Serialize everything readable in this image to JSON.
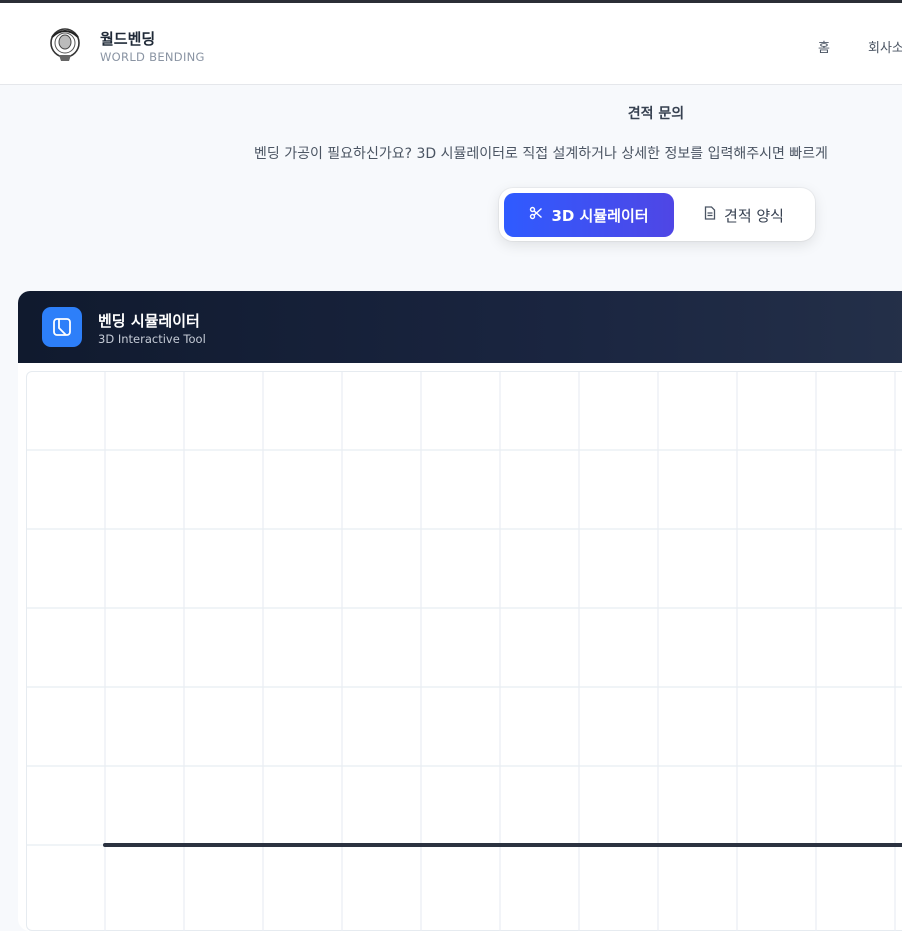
{
  "header": {
    "brand_ko": "월드벤딩",
    "brand_en": "WORLD BENDING",
    "nav": [
      "홈",
      "회사소"
    ]
  },
  "main": {
    "title": "견적 문의",
    "subtitle": "벤딩 가공이 필요하신가요? 3D 시뮬레이터로 직접 설계하거나 상세한 정보를 입력해주시면 빠르게",
    "tabs": [
      {
        "label": "3D 시뮬레이터",
        "icon": "scissors-icon",
        "active": true
      },
      {
        "label": "견적 양식",
        "icon": "document-icon",
        "active": false
      }
    ]
  },
  "simulator": {
    "title": "벤딩 시뮬레이터",
    "subtitle": "3D Interactive Tool",
    "icon": "bend-icon"
  },
  "colors": {
    "accent": "#2f5bff",
    "header_dark": "#101a2e",
    "icon_blue": "#2d7ff9",
    "grid": "#e8edf2",
    "bar": "#2b3240"
  }
}
